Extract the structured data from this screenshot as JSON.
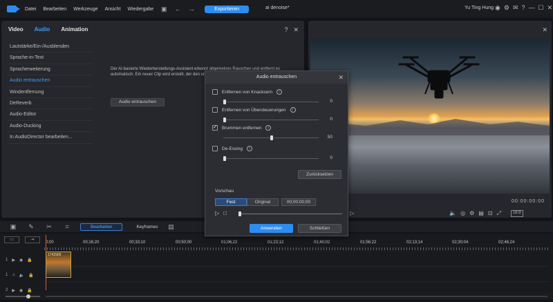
{
  "menubar": {
    "items": [
      "Datei",
      "Bearbeiten",
      "Werkzeuge",
      "Ansicht",
      "Wiedergabe"
    ],
    "export_label": "Exportieren",
    "doc_title": "ai denoise*",
    "user_name": "Yu Ting Hung"
  },
  "left_panel": {
    "tabs": [
      "Video",
      "Audio",
      "Animation"
    ],
    "active_tab": "Audio",
    "help": "?",
    "close": "✕",
    "sidebar": [
      "Lautstärke/Ein-/Ausblenden",
      "Sprache-in-Text",
      "Spracherweiterung",
      "Audio entrauschen",
      "Windentfernung",
      "DeReverb",
      "Audio-Editor",
      "Audio-Ducking",
      "In AudioDirector bearbeiten..."
    ],
    "active_item": "Audio entrauschen",
    "description": "Der AI-basierte Wiederherstellungs-Assistent erkennt allgemeines Rauschen und entfernt es automatisch. Ein neuer Clip wird erstellt, der den ursprünglichen Clip auf der Zeitachse ersetzen soll.",
    "action_button": "Audio entrauschen"
  },
  "preview": {
    "time": "00:00:00:00",
    "ratio": "16:9"
  },
  "dialog": {
    "title": "Audio entrauschen",
    "options": [
      {
        "label": "Entfernen von Knacksern",
        "checked": false,
        "value": "0"
      },
      {
        "label": "Entfernen von Übersteuerungen",
        "checked": false,
        "value": "0"
      },
      {
        "label": "Brummen entfernen",
        "checked": true,
        "value": "50"
      },
      {
        "label": "De-Essing",
        "checked": false,
        "value": "0"
      }
    ],
    "reset_label": "Zurücksetzen",
    "preview_label": "Vorschau",
    "segments": [
      "Fest",
      "Original"
    ],
    "time": "00;00;00;00",
    "apply_label": "Anwenden",
    "close_label": "Schließen"
  },
  "timeline": {
    "edit_label": "Bearbeiten",
    "keyframes_label": "Keyframes",
    "ruler": [
      "0;00",
      "00;16;20",
      "00;33;10",
      "00;50;00",
      "01;06;22",
      "01;23;12",
      "01;40;02",
      "01;56;22",
      "02;13;14",
      "02;30;04",
      "02;46;24"
    ],
    "tracks": [
      "1",
      "1",
      "2"
    ],
    "clip_label": "1742900"
  }
}
